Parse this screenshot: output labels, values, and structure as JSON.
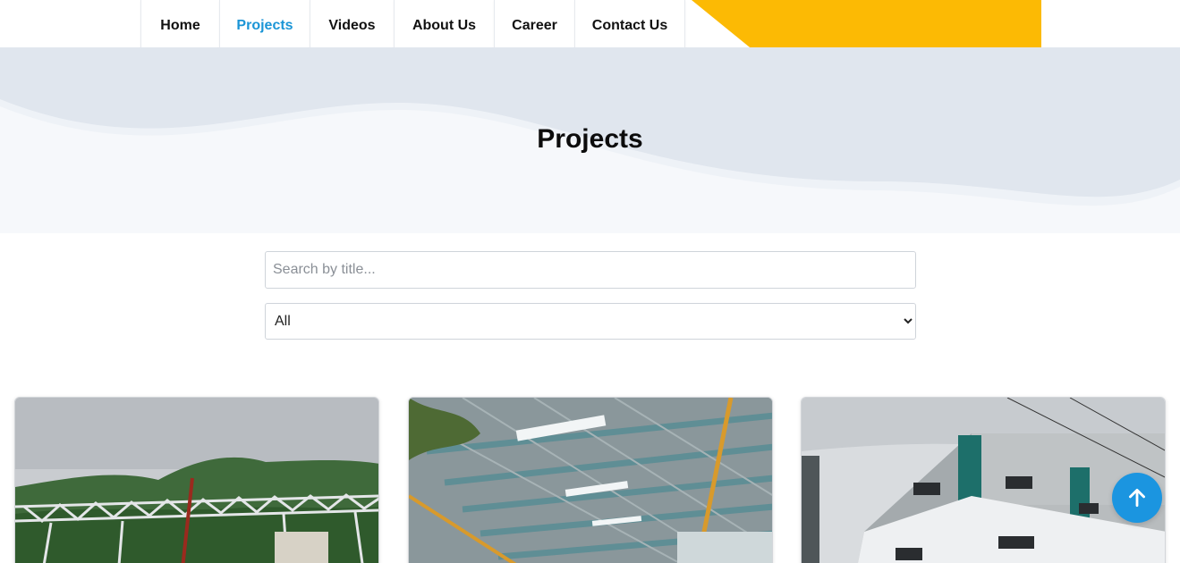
{
  "nav": {
    "items": [
      {
        "label": "Home",
        "active": false
      },
      {
        "label": "Projects",
        "active": true
      },
      {
        "label": "Videos",
        "active": false
      },
      {
        "label": "About Us",
        "active": false
      },
      {
        "label": "Career",
        "active": false
      },
      {
        "label": "Contact Us",
        "active": false
      }
    ]
  },
  "hero": {
    "title": "Projects"
  },
  "search": {
    "placeholder": "Search by title...",
    "value": ""
  },
  "filter": {
    "selected": "All",
    "options": [
      "All"
    ]
  },
  "projects": [
    {
      "image": "steel-truss-structure-photo"
    },
    {
      "image": "industrial-shed-roof-photo"
    },
    {
      "image": "factory-building-exterior-photo"
    }
  ],
  "back_to_top": {
    "icon": "arrow-up-icon"
  },
  "colors": {
    "accent": "#1b95d6",
    "brand_yellow": "#fcba04",
    "hero_bg": "#e0e6ee",
    "text": "#111111"
  }
}
